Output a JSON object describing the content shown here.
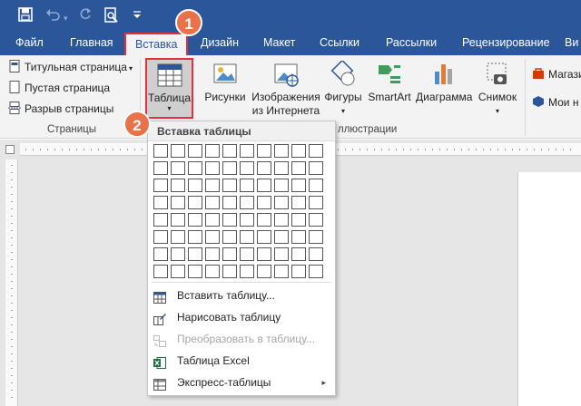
{
  "quick_access": {
    "save_icon": "save-icon",
    "undo_icon": "undo-icon",
    "redo_icon": "redo-icon",
    "print_preview_icon": "print-preview-icon",
    "customize_icon": "customize-qat-icon"
  },
  "tabs": [
    {
      "label": "Файл"
    },
    {
      "label": "Главная"
    },
    {
      "label": "Вставка",
      "active": true
    },
    {
      "label": "Дизайн"
    },
    {
      "label": "Макет"
    },
    {
      "label": "Ссылки"
    },
    {
      "label": "Рассылки"
    },
    {
      "label": "Рецензирование"
    },
    {
      "label": "Ви"
    }
  ],
  "ribbon": {
    "pages_group": {
      "items": [
        "Титульная страница",
        "Пустая страница",
        "Разрыв страницы"
      ],
      "label": "Страницы"
    },
    "table_button": {
      "label": "Таблица",
      "arrow": "▾"
    },
    "illustrations": {
      "pictures": "Рисунки",
      "online_pictures_line1": "Изображения",
      "online_pictures_line2": "из Интернета",
      "shapes": "Фигуры",
      "smartart": "SmartArt",
      "chart": "Диаграмма",
      "screenshot": "Снимок",
      "group_label": "ллюстрации"
    },
    "addins": {
      "store": "Магази",
      "my_addins": "Мои н"
    }
  },
  "callouts": {
    "one": "1",
    "two": "2"
  },
  "dropdown": {
    "header": "Вставка таблицы",
    "grid": {
      "columns": 10,
      "rows": 8
    },
    "items": [
      {
        "label": "Вставить таблицу...",
        "enabled": true,
        "icon": "insert-table-icon"
      },
      {
        "label": "Нарисовать таблицу",
        "enabled": true,
        "icon": "draw-table-icon"
      },
      {
        "label": "Преобразовать в таблицу...",
        "enabled": false,
        "icon": "convert-table-icon"
      },
      {
        "label": "Таблица Excel",
        "enabled": true,
        "icon": "excel-icon"
      },
      {
        "label": "Экспресс-таблицы",
        "enabled": true,
        "icon": "quick-tables-icon",
        "submenu": "▸"
      }
    ]
  },
  "colors": {
    "title_bar": "#2b579a",
    "highlight": "#e0323c",
    "callout": "#e8734a"
  }
}
